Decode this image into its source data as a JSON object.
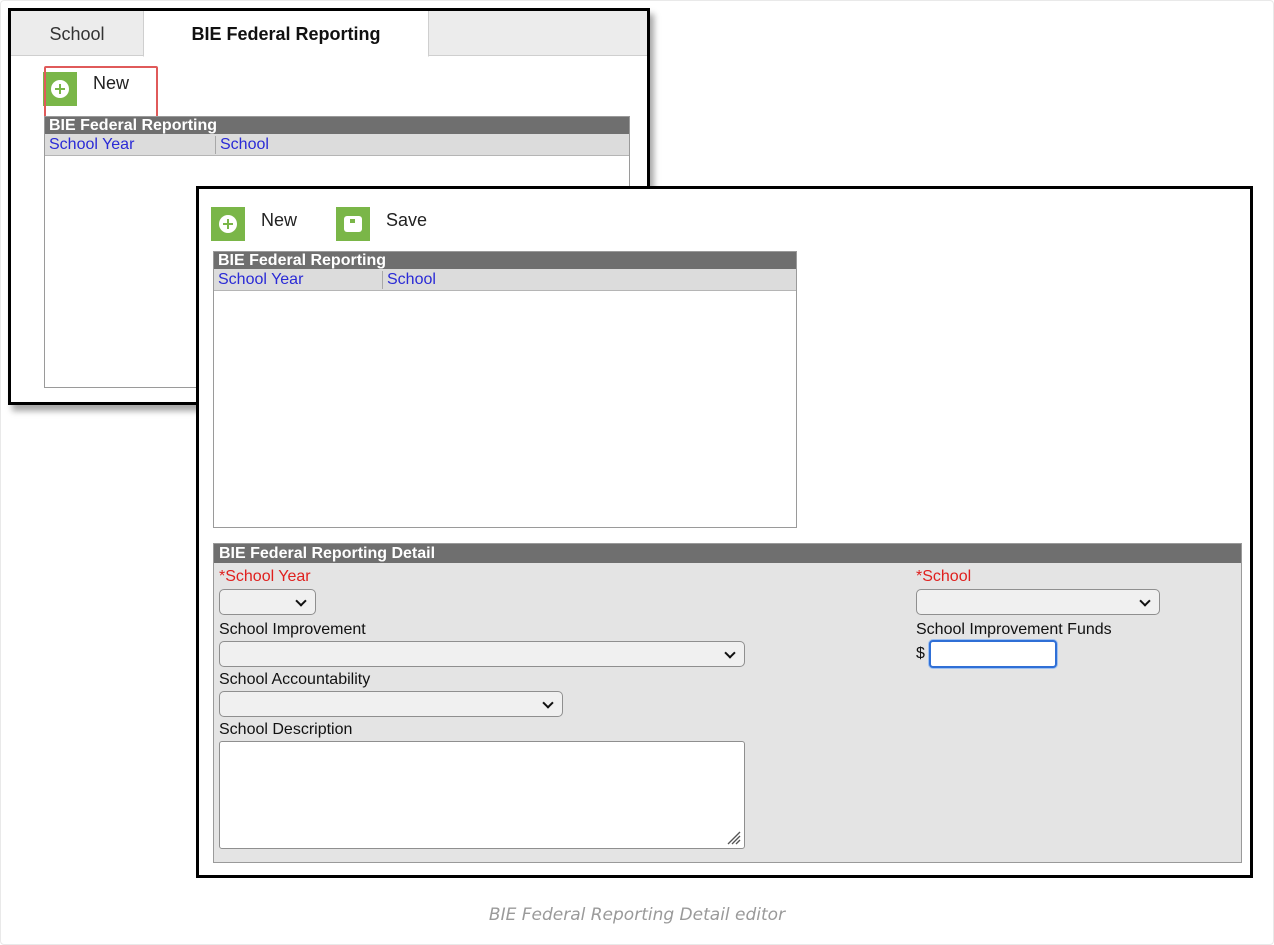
{
  "tabs": [
    {
      "label": "School"
    },
    {
      "label": "BIE Federal Reporting"
    }
  ],
  "back_window": {
    "new_label": "New",
    "grid": {
      "title": "BIE Federal Reporting",
      "columns": [
        "School Year",
        "School"
      ]
    }
  },
  "front_window": {
    "toolbar": {
      "new_label": "New",
      "save_label": "Save"
    },
    "grid": {
      "title": "BIE Federal Reporting",
      "columns": [
        "School Year",
        "School"
      ]
    },
    "detail": {
      "title": "BIE Federal Reporting Detail",
      "school_year_label": "*School Year",
      "school_label": "*School",
      "school_improvement_label": "School Improvement",
      "school_improvement_funds_label": "School Improvement Funds",
      "currency_symbol": "$",
      "school_accountability_label": "School Accountability",
      "school_description_label": "School Description"
    }
  },
  "caption": "BIE Federal Reporting Detail editor",
  "colors": {
    "accent_green": "#7ab648",
    "required_red": "#e0201e",
    "link_blue": "#2a2ad6",
    "highlight_red": "#e05a5a"
  },
  "icons": [
    "plus-circle-icon",
    "save-icon",
    "chevron-down-icon",
    "resize-grip-icon"
  ]
}
